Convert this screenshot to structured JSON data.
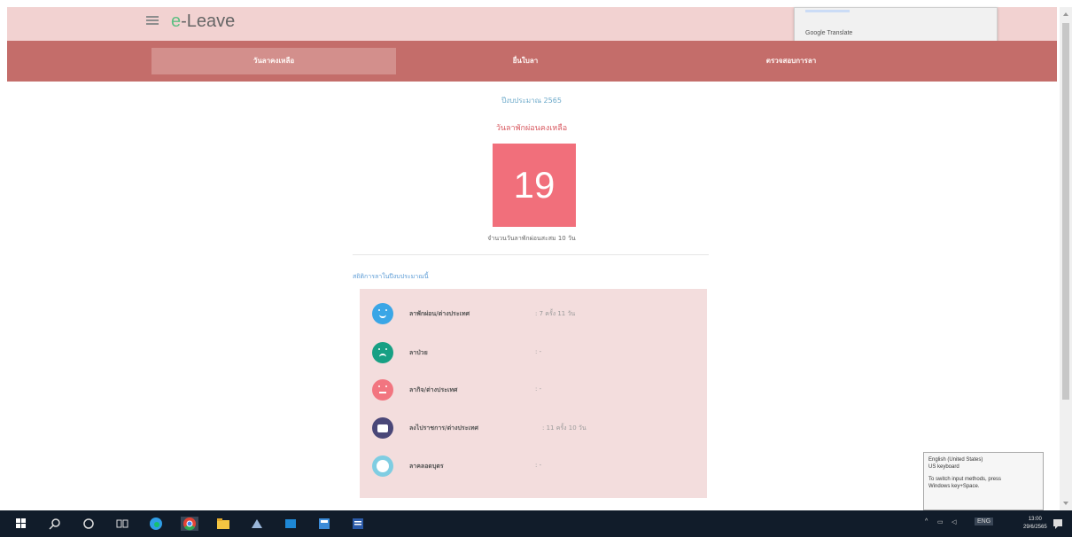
{
  "header": {
    "brand_prefix": "e",
    "brand_suffix": "-Leave"
  },
  "translate_popup": {
    "label": "Google Translate"
  },
  "nav": {
    "tabs": [
      {
        "label": "วันลาคงเหลือ",
        "active": true
      },
      {
        "label": "ยื่นใบลา"
      },
      {
        "label": "ตรวจสอบการลา"
      }
    ]
  },
  "main": {
    "fiscal_year": "ปีงบประมาณ 2565",
    "remaining_title": "วันลาพักผ่อนคงเหลือ",
    "remaining_days": "19",
    "total_line": "จำนวนวันลาพักผ่อนสะสม 10 วัน",
    "stats_title": "สถิติการลาในปีงบประมาณนี้"
  },
  "leave_stats": [
    {
      "name": "ลาพักผ่อน/ต่างประเทศ",
      "value": ": 7 ครั้ง 11 วัน",
      "color": "#3aa6e6",
      "icon": "smile-face-icon"
    },
    {
      "name": "ลาป่วย",
      "value": ": -",
      "color": "#17a084",
      "icon": "sad-face-icon"
    },
    {
      "name": "ลากิจ/ต่างประเทศ",
      "value": ": -",
      "color": "#f27580",
      "icon": "neutral-face-icon"
    },
    {
      "name": "ลงไปราชการ/ต่างประเทศ",
      "value": ": 11 ครั้ง 10 วัน",
      "color": "#4a4778",
      "icon": "briefcase-icon"
    },
    {
      "name": "ลาคลอดบุตร",
      "value": ": -",
      "color": "#7fcde2",
      "icon": "baby-icon"
    }
  ],
  "ime_tooltip": {
    "line1": "English (United States)",
    "line2": "US keyboard",
    "line3": "To switch input methods, press",
    "line4": "Windows key+Space."
  },
  "taskbar": {
    "tray_lang": "ENG",
    "time": "13:00",
    "date": "29/6/2565"
  }
}
